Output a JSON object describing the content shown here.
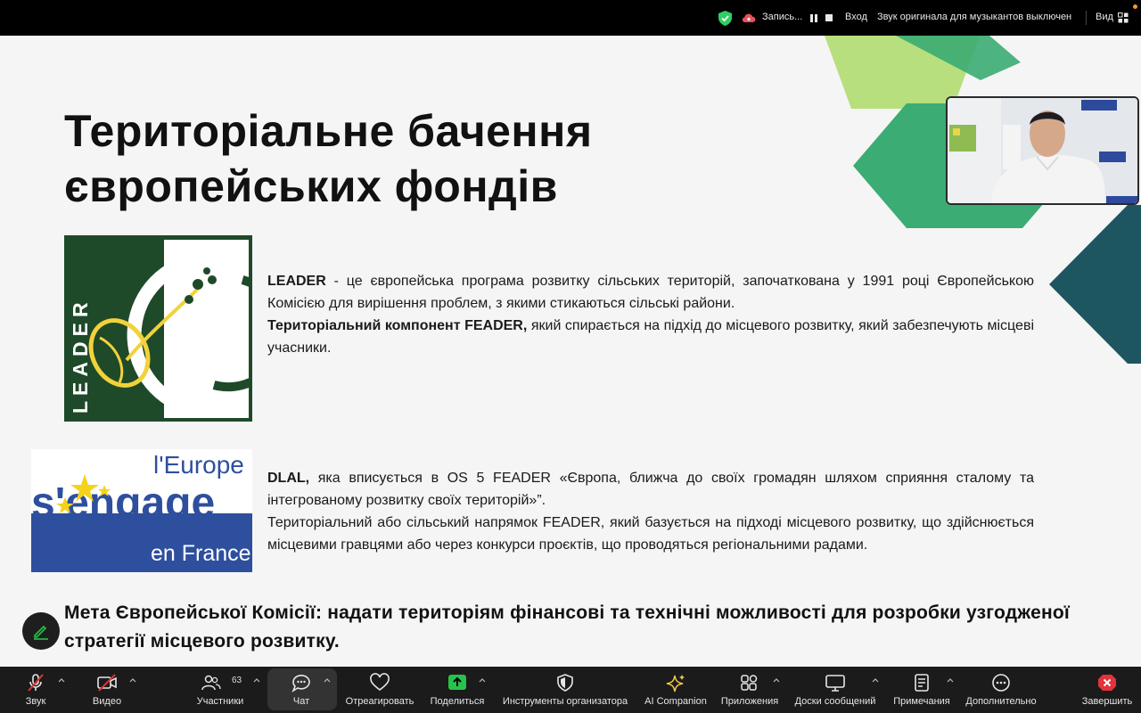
{
  "topbar": {
    "recording_label": "Запись...",
    "enter_label": "Вход",
    "original_sound_label": "Звук оригинала для музыкантов выключен",
    "view_label": "Вид"
  },
  "slide": {
    "title_line1": "Територіальне бачення",
    "title_line2": "європейських фондів",
    "leader_logo_text": "LEADER",
    "engage_logo": {
      "line1": "l'Europe",
      "line2": "s'engage",
      "line3": "en France"
    },
    "p1": {
      "s1_bold": "LEADER",
      "s1_rest": " - це європейська програма розвитку сільських територій, започаткована у 1991 році Європейською Комісією для вирішення проблем, з якими стикаються сільські райони.",
      "s2_bold": "Територіальний компонент FEADER,",
      "s2_rest": " який спирається на підхід до місцевого розвитку, який забезпечують місцеві учасники."
    },
    "p2": {
      "s1_bold": "DLAL,",
      "s1_rest": " яка вписується в OS 5 FEADER «Європа, ближча до своїх громадян шляхом сприяння сталому та інтегрованому розвитку своїх територій»”.",
      "s2": "Територіальний або сільський напрямок FEADER, який базується на підході місцевого розвитку, що здійснюється місцевими гравцями або через конкурси проєктів, що проводяться регіональними радами."
    },
    "goal": "Мета Європейської Комісії: надати територіям фінансові та технічні можливості для розробки узгодженої стратегії місцевого розвитку."
  },
  "toolbar": {
    "audio_label": "Звук",
    "video_label": "Видео",
    "participants_label": "Участники",
    "participants_count": "63",
    "chat_label": "Чат",
    "react_label": "Отреагировать",
    "share_label": "Поделиться",
    "host_tools_label": "Инструменты организатора",
    "ai_label": "AI Companion",
    "apps_label": "Приложения",
    "whiteboards_label": "Доски сообщений",
    "notes_label": "Примечания",
    "more_label": "Дополнительно",
    "end_label": "Завершить"
  },
  "colors": {
    "leader_green": "#1f4a2a",
    "leader_yellow": "#f2d23a",
    "europe_blue": "#2e4f9e",
    "hex_light_green": "#b8df7d",
    "hex_green": "#3bac73",
    "hex_teal": "#1d5661",
    "share_green": "#27c24c",
    "end_red": "#e0333b"
  }
}
